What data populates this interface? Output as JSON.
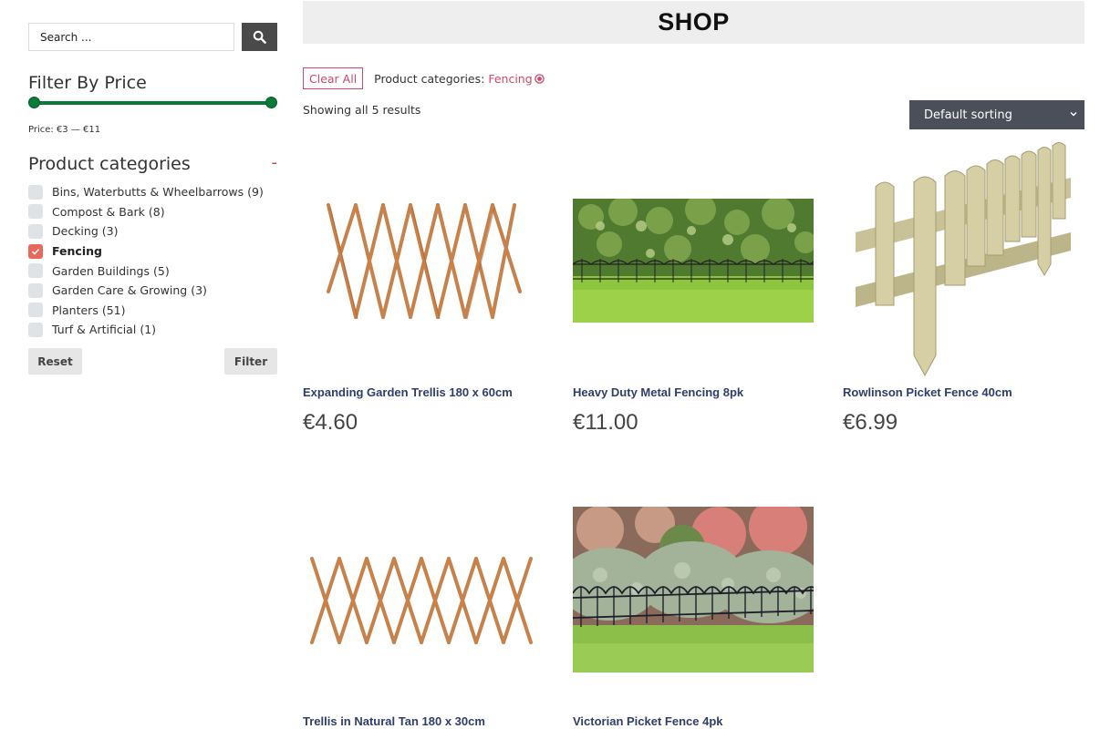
{
  "search": {
    "placeholder": "Search ..."
  },
  "price_filter": {
    "title": "Filter By Price",
    "price_text": "Price: €3 — €11",
    "min_fraction": 0.0,
    "max_fraction": 1.0
  },
  "categories": {
    "title": "Product categories",
    "toggle": "-",
    "items": [
      {
        "label": "Bins, Waterbutts & Wheelbarrows",
        "count": "(9)",
        "checked": false
      },
      {
        "label": "Compost & Bark",
        "count": "(8)",
        "checked": false
      },
      {
        "label": "Decking",
        "count": "(3)",
        "checked": false
      },
      {
        "label": "Fencing",
        "count": "",
        "checked": true
      },
      {
        "label": "Garden Buildings",
        "count": "(5)",
        "checked": false
      },
      {
        "label": "Garden Care & Growing",
        "count": "(3)",
        "checked": false
      },
      {
        "label": "Planters",
        "count": "(51)",
        "checked": false
      },
      {
        "label": "Turf & Artificial",
        "count": "(1)",
        "checked": false
      }
    ],
    "reset_label": "Reset",
    "filter_label": "Filter"
  },
  "shop": {
    "title": "SHOP",
    "clear_all": "Clear All",
    "active_filter_label": "Product categories:",
    "active_filter_value": "Fencing",
    "result_count": "Showing all 5 results",
    "sort_label": "Default sorting"
  },
  "products": [
    {
      "name": "Expanding Garden Trellis 180 x 60cm",
      "price": "€4.60",
      "image": "trellis-wide"
    },
    {
      "name": "Heavy Duty Metal Fencing 8pk",
      "price": "€11.00",
      "image": "metal-fencing-hedge"
    },
    {
      "name": "Rowlinson Picket Fence 40cm",
      "price": "€6.99",
      "image": "wooden-picket-fence"
    },
    {
      "name": "Trellis in Natural Tan 180 x 30cm",
      "price": "",
      "image": "trellis-tan"
    },
    {
      "name": "Victorian Picket Fence 4pk",
      "price": "",
      "image": "victorian-fence-garden"
    }
  ],
  "colors": {
    "accent_green": "#0a7a3a",
    "accent_pink": "#d2476a",
    "checkbox_checked": "#e8695c",
    "product_title": "#2f3e6b",
    "sort_bg": "#4a4f59"
  }
}
